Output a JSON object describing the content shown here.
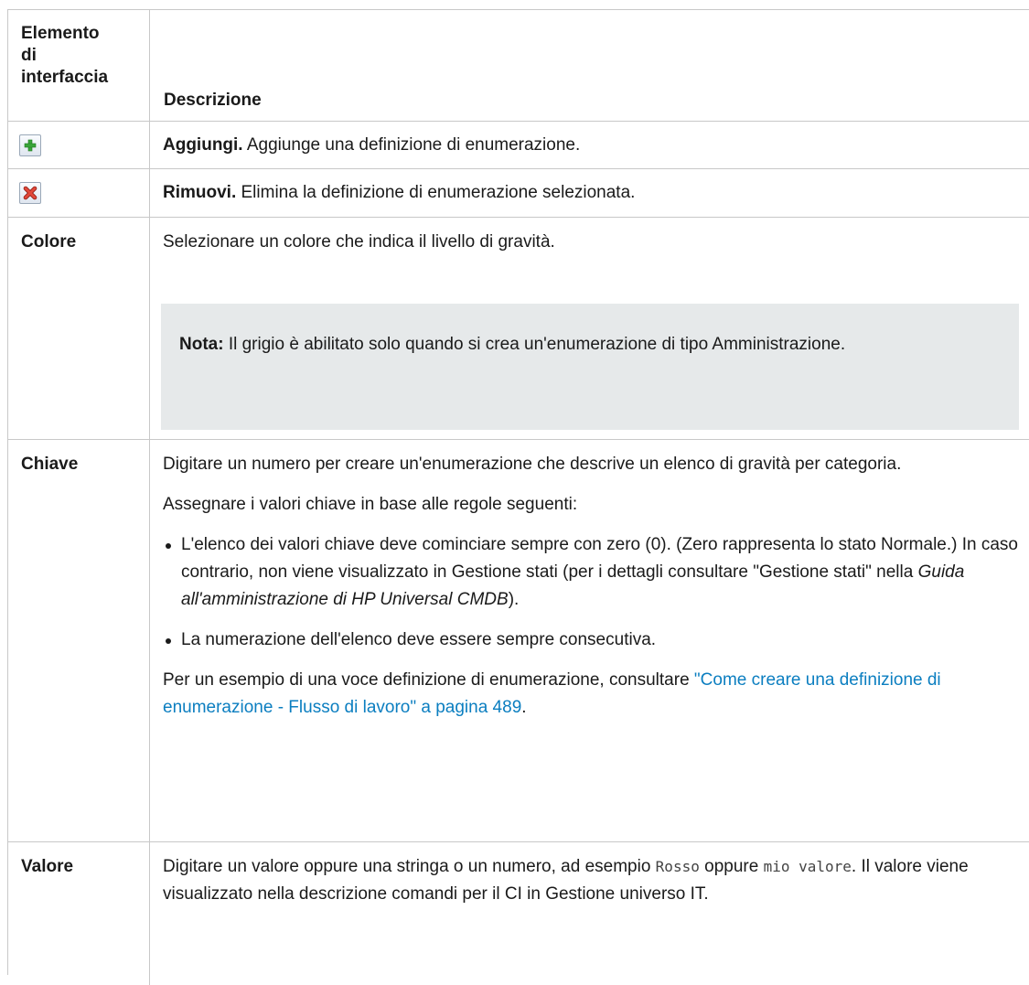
{
  "header": {
    "col1": "Elemento di interfaccia",
    "col1_lines": [
      "Elemento",
      "di",
      "interfaccia"
    ],
    "col2": "Descrizione"
  },
  "rows": {
    "add": {
      "icon": "add-icon",
      "title": "Aggiungi.",
      "text": " Aggiunge una definizione di enumerazione."
    },
    "remove": {
      "icon": "remove-icon",
      "title": "Rimuovi.",
      "text": " Elimina la definizione di enumerazione selezionata."
    },
    "color": {
      "label": "Colore",
      "text": "Selezionare un colore che indica il livello di gravità.",
      "note_title": "Nota:",
      "note_text": " Il grigio è abilitato solo quando si crea un'enumerazione di tipo Amministrazione."
    },
    "key": {
      "label": "Chiave",
      "text1": "Digitare un numero per creare un'enumerazione che descrive un elenco di gravità per categoria.",
      "text2": "Assegnare i valori chiave in base alle regole seguenti:",
      "bullet1_a": "L'elenco dei valori chiave deve cominciare sempre con zero (0). (Zero rappresenta lo stato Normale.) In caso contrario, non viene visualizzato in Gestione stati (per i dettagli consultare \"Gestione stati\" nella ",
      "bullet1_italic": "Guida all'amministrazione di HP Universal CMDB",
      "bullet1_b": ").",
      "bullet2": "La numerazione dell'elenco deve essere sempre consecutiva.",
      "text3_a": "Per un esempio di una voce definizione di enumerazione, consultare ",
      "text3_link": "\"Come creare una definizione di enumerazione - Flusso di lavoro\" a pagina 489",
      "text3_b": "."
    },
    "value": {
      "label": "Valore",
      "text_a": "Digitare un valore oppure una stringa o un numero, ad esempio ",
      "code1": "Rosso",
      "text_b": " oppure ",
      "code2": "mio valore",
      "text_c": ". Il valore viene visualizzato nella descrizione comandi per il CI in Gestione universo IT."
    }
  },
  "colors": {
    "border": "#c8c8c8",
    "note_bg": "#e6e9ea",
    "link": "#0b7ec0",
    "add_icon": "#3aa53a",
    "remove_icon": "#d8382b"
  }
}
